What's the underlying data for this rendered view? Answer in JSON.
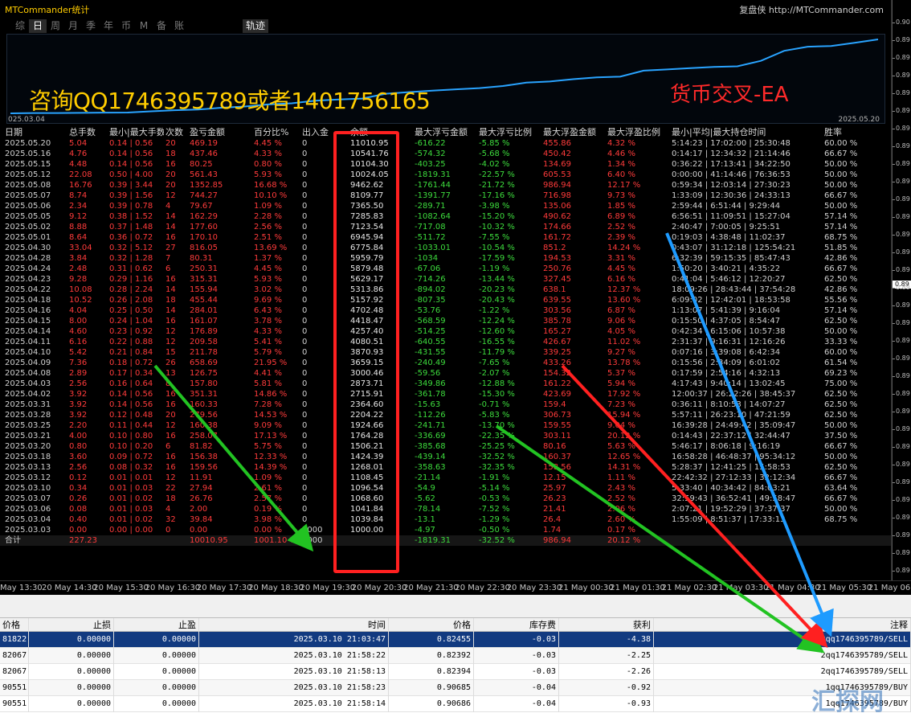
{
  "app_title": "MTCommander统计",
  "site_link": "复盘侠 http://MTCommander.com",
  "period_tabs": [
    "综",
    "日",
    "周",
    "月",
    "季",
    "年",
    "币",
    "M",
    "备",
    "账户"
  ],
  "active_tab": "日",
  "track_button": "轨迹",
  "equity_chart": {
    "start_date": "025.03.04",
    "end_date": "2025.05.20",
    "line_color": "#29a3ff"
  },
  "watermark": {
    "contact": "咨询QQ1746395789或者1401756165",
    "ea": "货币交叉-EA"
  },
  "stats": {
    "headers": [
      "日期",
      "总手数",
      "最小|最大手数",
      "次数",
      "盈亏金额",
      "百分比%",
      "出入金",
      "余额",
      "最大浮亏金额",
      "最大浮亏比例",
      "最大浮盈金额",
      "最大浮盈比例",
      "最小|平均|最大持仓时间",
      "胜率"
    ],
    "rows": [
      [
        "2025.05.20",
        "5.04",
        "0.14 | 0.56",
        "20",
        "469.19",
        "4.45 %",
        "0",
        "11010.95",
        "-616.22",
        "-5.85 %",
        "455.86",
        "4.32 %",
        "5:14:23 | 17:02:00 | 25:30:48",
        "60.00 %"
      ],
      [
        "2025.05.16",
        "4.76",
        "0.14 | 0.56",
        "18",
        "437.46",
        "4.33 %",
        "0",
        "10541.76",
        "-574.32",
        "-5.68 %",
        "450.42",
        "4.46 %",
        "0:14:17 | 12:34:32 | 21:14:46",
        "66.67 %"
      ],
      [
        "2025.05.15",
        "4.48",
        "0.14 | 0.56",
        "16",
        "80.25",
        "0.80 %",
        "0",
        "10104.30",
        "-403.25",
        "-4.02 %",
        "134.69",
        "1.34 %",
        "0:36:22 | 17:13:41 | 34:22:50",
        "50.00 %"
      ],
      [
        "2025.05.12",
        "22.08",
        "0.50 | 4.00",
        "20",
        "561.43",
        "5.93 %",
        "0",
        "10024.05",
        "-1819.31",
        "-22.57 %",
        "605.53",
        "6.40 %",
        "0:00:00 | 41:14:46 | 76:36:53",
        "50.00 %"
      ],
      [
        "2025.05.08",
        "16.76",
        "0.39 | 3.44",
        "20",
        "1352.85",
        "16.68 %",
        "0",
        "9462.62",
        "-1761.44",
        "-21.72 %",
        "986.94",
        "12.17 %",
        "0:59:34 | 12:03:14 | 27:30:23",
        "50.00 %"
      ],
      [
        "2025.05.07",
        "8.74",
        "0.39 | 1.56",
        "12",
        "744.27",
        "10.10 %",
        "0",
        "8109.77",
        "-1391.77",
        "-17.16 %",
        "716.98",
        "9.73 %",
        "1:33:09 | 12:30:36 | 24:33:13",
        "66.67 %"
      ],
      [
        "2025.05.06",
        "2.34",
        "0.39 | 0.78",
        "4",
        "79.67",
        "1.09 %",
        "0",
        "7365.50",
        "-289.71",
        "-3.98 %",
        "135.06",
        "1.85 %",
        "2:59:44 | 6:51:44 | 9:29:44",
        "50.00 %"
      ],
      [
        "2025.05.05",
        "9.12",
        "0.38 | 1.52",
        "14",
        "162.29",
        "2.28 %",
        "0",
        "7285.83",
        "-1082.64",
        "-15.20 %",
        "490.62",
        "6.89 %",
        "6:56:51 | 11:09:51 | 15:27:04",
        "57.14 %"
      ],
      [
        "2025.05.02",
        "8.88",
        "0.37 | 1.48",
        "14",
        "177.60",
        "2.56 %",
        "0",
        "7123.54",
        "-717.08",
        "-10.32 %",
        "174.66",
        "2.52 %",
        "2:40:47 | 7:00:05 | 9:25:51",
        "57.14 %"
      ],
      [
        "2025.05.01",
        "8.64",
        "0.36 | 0.72",
        "16",
        "170.10",
        "2.51 %",
        "0",
        "6945.94",
        "-511.72",
        "-7.55 %",
        "161.72",
        "2.39 %",
        "0:19:03 | 4:38:48 | 11:02:37",
        "68.75 %"
      ],
      [
        "2025.04.30",
        "33.04",
        "0.32 | 5.12",
        "27",
        "816.05",
        "13.69 %",
        "0",
        "6775.84",
        "-1033.01",
        "-10.54 %",
        "851.2",
        "14.24 %",
        "0:43:07 | 31:12:18 | 125:54:21",
        "51.85 %"
      ],
      [
        "2025.04.28",
        "3.84",
        "0.32 | 1.28",
        "7",
        "80.31",
        "1.37 %",
        "0",
        "5959.79",
        "-1034",
        "-17.59 %",
        "194.53",
        "3.31 %",
        "6:32:39 | 59:15:35 | 85:47:43",
        "42.86 %"
      ],
      [
        "2025.04.24",
        "2.48",
        "0.31 | 0.62",
        "6",
        "250.31",
        "4.45 %",
        "0",
        "5879.48",
        "-67.06",
        "-1.19 %",
        "250.76",
        "4.45 %",
        "1:50:20 | 3:40:21 | 4:35:22",
        "66.67 %"
      ],
      [
        "2025.04.23",
        "9.28",
        "0.29 | 1.16",
        "16",
        "315.31",
        "5.93 %",
        "0",
        "5629.17",
        "-714.26",
        "-13.44 %",
        "327.45",
        "6.16 %",
        "0:41:04 | 5:46:12 | 12:20:27",
        "62.50 %"
      ],
      [
        "2025.04.22",
        "10.08",
        "0.28 | 2.24",
        "14",
        "155.94",
        "3.02 %",
        "0",
        "5313.86",
        "-894.02",
        "-20.23 %",
        "638.1",
        "12.37 %",
        "18:09:26 | 28:43:44 | 37:54:28",
        "42.86 %"
      ],
      [
        "2025.04.18",
        "10.52",
        "0.26 | 2.08",
        "18",
        "455.44",
        "9.69 %",
        "0",
        "5157.92",
        "-807.35",
        "-20.43 %",
        "639.55",
        "13.60 %",
        "6:09:02 | 12:42:01 | 18:53:58",
        "55.56 %"
      ],
      [
        "2025.04.16",
        "4.04",
        "0.25 | 0.50",
        "14",
        "284.01",
        "6.43 %",
        "0",
        "4702.48",
        "-53.76",
        "-1.22 %",
        "303.56",
        "6.87 %",
        "1:13:07 | 5:41:39 | 9:16:04",
        "57.14 %"
      ],
      [
        "2025.04.15",
        "8.00",
        "0.24 | 1.04",
        "16",
        "161.07",
        "3.78 %",
        "0",
        "4418.47",
        "-568.59",
        "-12.24 %",
        "385.78",
        "9.06 %",
        "0:15:50 | 4:37:05 | 8:54:47",
        "62.50 %"
      ],
      [
        "2025.04.14",
        "4.60",
        "0.23 | 0.92",
        "12",
        "176.89",
        "4.33 %",
        "0",
        "4257.40",
        "-514.25",
        "-12.60 %",
        "165.27",
        "4.05 %",
        "0:42:34 | 6:15:06 | 10:57:38",
        "50.00 %"
      ],
      [
        "2025.04.11",
        "6.16",
        "0.22 | 0.88",
        "12",
        "209.58",
        "5.41 %",
        "0",
        "4080.51",
        "-640.55",
        "-16.55 %",
        "426.67",
        "11.02 %",
        "2:31:37 | 9:16:31 | 12:16:26",
        "33.33 %"
      ],
      [
        "2025.04.10",
        "5.42",
        "0.21 | 0.84",
        "15",
        "211.78",
        "5.79 %",
        "0",
        "3870.93",
        "-431.55",
        "-11.79 %",
        "339.25",
        "9.27 %",
        "0:07:16 | 3:39:08 | 6:42:34",
        "60.00 %"
      ],
      [
        "2025.04.09",
        "7.36",
        "0.18 | 0.72",
        "26",
        "658.69",
        "21.95 %",
        "0",
        "3659.15",
        "-240.49",
        "-7.65 %",
        "433.26",
        "13.78 %",
        "0:15:56 | 2:34:09 | 6:01:02",
        "61.54 %"
      ],
      [
        "2025.04.08",
        "2.89",
        "0.17 | 0.34",
        "13",
        "126.75",
        "4.41 %",
        "0",
        "3000.46",
        "-59.56",
        "-2.07 %",
        "154.32",
        "5.37 %",
        "0:17:59 | 2:54:16 | 4:32:13",
        "69.23 %"
      ],
      [
        "2025.04.03",
        "2.56",
        "0.16 | 0.64",
        "8",
        "157.80",
        "5.81 %",
        "0",
        "2873.71",
        "-349.86",
        "-12.88 %",
        "161.22",
        "5.94 %",
        "4:17:43 | 9:40:14 | 13:02:45",
        "75.00 %"
      ],
      [
        "2025.04.02",
        "3.92",
        "0.14 | 0.56",
        "16",
        "351.31",
        "14.86 %",
        "0",
        "2715.91",
        "-361.78",
        "-15.30 %",
        "423.69",
        "17.92 %",
        "12:00:37 | 26:22:26 | 38:45:37",
        "62.50 %"
      ],
      [
        "2025.03.31",
        "3.92",
        "0.14 | 0.56",
        "16",
        "160.33",
        "7.28 %",
        "0",
        "2364.60",
        "-15.63",
        "-0.71 %",
        "159.4",
        "7.23 %",
        "0:36:11 | 8:10:53 | 14:07:27",
        "62.50 %"
      ],
      [
        "2025.03.28",
        "3.92",
        "0.12 | 0.48",
        "20",
        "279.56",
        "14.53 %",
        "0",
        "2204.22",
        "-112.26",
        "-5.83 %",
        "306.73",
        "15.94 %",
        "5:57:11 | 26:23:10 | 47:21:59",
        "62.50 %"
      ],
      [
        "2025.03.25",
        "2.20",
        "0.11 | 0.44",
        "12",
        "160.38",
        "9.09 %",
        "0",
        "1924.66",
        "-241.71",
        "-13.70 %",
        "159.55",
        "9.04 %",
        "16:39:28 | 24:49:42 | 35:09:47",
        "50.00 %"
      ],
      [
        "2025.03.21",
        "4.00",
        "0.10 | 0.80",
        "16",
        "258.07",
        "17.13 %",
        "0",
        "1764.28",
        "-336.69",
        "-22.35 %",
        "303.11",
        "20.12 %",
        "0:14:43 | 22:37:12 | 32:44:47",
        "37.50 %"
      ],
      [
        "2025.03.20",
        "0.80",
        "0.10 | 0.20",
        "6",
        "81.82",
        "5.75 %",
        "0",
        "1506.21",
        "-385.68",
        "-25.25 %",
        "80.16",
        "5.63 %",
        "5:46:17 | 8:06:18 | 9:16:19",
        "66.67 %"
      ],
      [
        "2025.03.18",
        "3.60",
        "0.09 | 0.72",
        "16",
        "156.38",
        "12.33 %",
        "0",
        "1424.39",
        "-439.14",
        "-32.52 %",
        "160.37",
        "12.65 %",
        "16:58:28 | 46:48:37 | 95:34:12",
        "50.00 %"
      ],
      [
        "2025.03.13",
        "2.56",
        "0.08 | 0.32",
        "16",
        "159.56",
        "14.39 %",
        "0",
        "1268.01",
        "-358.63",
        "-32.35 %",
        "158.56",
        "14.31 %",
        "5:28:37 | 12:41:25 | 15:58:53",
        "62.50 %"
      ],
      [
        "2025.03.12",
        "0.12",
        "0.01 | 0.01",
        "12",
        "11.91",
        "1.09 %",
        "0",
        "1108.45",
        "-21.14",
        "-1.91 %",
        "12.15",
        "1.11 %",
        "22:42:32 | 27:12:33 | 32:12:34",
        "66.67 %"
      ],
      [
        "2025.03.10",
        "0.34",
        "0.01 | 0.03",
        "22",
        "27.94",
        "2.61 %",
        "0",
        "1096.54",
        "-54.9",
        "-5.14 %",
        "25.97",
        "2.43 %",
        "5:33:40 | 40:34:42 | 84:03:21",
        "63.64 %"
      ],
      [
        "2025.03.07",
        "0.26",
        "0.01 | 0.02",
        "18",
        "26.76",
        "2.57 %",
        "0",
        "1068.60",
        "-5.62",
        "-0.53 %",
        "26.23",
        "2.52 %",
        "32:59:43 | 36:52:41 | 49:58:47",
        "66.67 %"
      ],
      [
        "2025.03.06",
        "0.08",
        "0.01 | 0.03",
        "4",
        "2.00",
        "0.19 %",
        "0",
        "1041.84",
        "-78.14",
        "-7.52 %",
        "21.41",
        "2.06 %",
        "2:07:21 | 19:52:29 | 37:37:37",
        "50.00 %"
      ],
      [
        "2025.03.04",
        "0.40",
        "0.01 | 0.02",
        "32",
        "39.84",
        "3.98 %",
        "0",
        "1039.84",
        "-13.1",
        "-1.29 %",
        "26.4",
        "2.60 %",
        "1:55:09 | 8:51:37 | 17:33:13",
        "68.75 %"
      ],
      [
        "2025.03.03",
        "0.00",
        "0.00 | 0.00",
        "0",
        "0.00",
        "0.00 %",
        "1000",
        "1000.00",
        "-4.97",
        "-0.50 %",
        "1.74",
        "0.17 %",
        "",
        ""
      ]
    ],
    "total": [
      "合计",
      "227.23",
      "",
      "",
      "10010.95",
      "1001.10 %",
      "1000",
      "",
      "-1819.31",
      "-32.52 %",
      "986.94",
      "20.12 %",
      "",
      ""
    ]
  },
  "price_axis": {
    "labels": [
      "0.90",
      "0.89",
      "0.89",
      "0.89",
      "0.89",
      "0.89",
      "0.89",
      "0.89",
      "0.89",
      "0.89",
      "0.89",
      "0.89",
      "0.89",
      "0.89",
      "0.89",
      "0.89",
      "0.89",
      "0.89",
      "0.89",
      "0.89",
      "0.89",
      "0.89",
      "0.89",
      "0.89",
      "0.89",
      "0.89",
      "0.89",
      "0.89",
      "0.89",
      "0.89",
      "0.89",
      "0.89"
    ],
    "marker": "0.89"
  },
  "time_axis": [
    "May 13:30",
    "20 May 14:30",
    "20 May 15:30",
    "20 May 16:30",
    "20 May 17:30",
    "20 May 18:30",
    "20 May 19:30",
    "20 May 20:30",
    "20 May 21:30",
    "20 May 22:30",
    "20 May 23:30",
    "21 May 00:30",
    "21 May 01:30",
    "21 May 02:30",
    "21 May 03:30",
    "21 May 04:30",
    "21 May 05:30",
    "21 May 06:30"
  ],
  "orders": {
    "headers": [
      "价格",
      "止损",
      "止盈",
      "时间",
      "价格",
      "库存费",
      "获利",
      "注释"
    ],
    "rows": [
      [
        "81822",
        "0.00000",
        "0.00000",
        "2025.03.10 21:03:47",
        "0.82455",
        "-0.03",
        "-4.38",
        "2qq1746395789/SELL"
      ],
      [
        "82067",
        "0.00000",
        "0.00000",
        "2025.03.10 21:58:22",
        "0.82392",
        "-0.03",
        "-2.25",
        "2qq1746395789/SELL"
      ],
      [
        "82067",
        "0.00000",
        "0.00000",
        "2025.03.10 21:58:13",
        "0.82394",
        "-0.03",
        "-2.26",
        "2qq1746395789/SELL"
      ],
      [
        "90551",
        "0.00000",
        "0.00000",
        "2025.03.10 21:58:23",
        "0.90685",
        "-0.04",
        "-0.92",
        "1qq1746395789/BUY"
      ],
      [
        "90551",
        "0.00000",
        "0.00000",
        "2025.03.10 21:58:14",
        "0.90686",
        "-0.04",
        "-0.93",
        "1qq1746395789/BUY"
      ]
    ]
  },
  "site_watermark": "汇探网",
  "colors": {
    "loss": "#3ddc3d",
    "profit": "#ff3b3b",
    "highlight": "#ff2020",
    "selected_row": "#123a80"
  }
}
